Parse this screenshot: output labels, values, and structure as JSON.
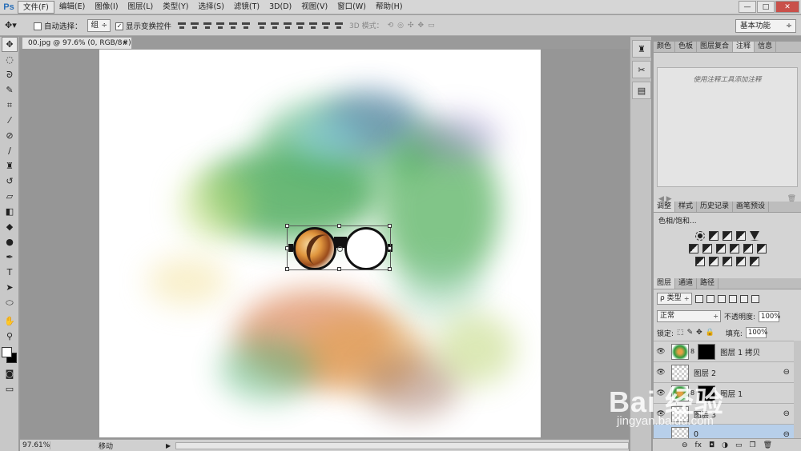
{
  "app": {
    "logo": "Ps"
  },
  "menu": [
    "文件(F)",
    "编辑(E)",
    "图像(I)",
    "图层(L)",
    "类型(Y)",
    "选择(S)",
    "滤镜(T)",
    "3D(D)",
    "视图(V)",
    "窗口(W)",
    "帮助(H)"
  ],
  "window_controls": {
    "minimize": "—",
    "restore": "□",
    "close": "✕"
  },
  "options": {
    "auto_select_label": "自动选择：",
    "auto_select_value": "组",
    "show_transform_label": "显示变换控件",
    "show_transform_checked": "✓",
    "mode3d_label": "3D 模式：",
    "workspace": "基本功能"
  },
  "document": {
    "tab_title": "00.jpg @ 97.6% (0, RGB/8#) *",
    "close": "×"
  },
  "status": {
    "zoom": "97.61%",
    "tool": "移动",
    "arrow": "▶"
  },
  "notes_panel": {
    "tabs": [
      "颜色",
      "色板",
      "图层复合",
      "注释",
      "信息"
    ],
    "active_tab": 3,
    "hint": "使用注释工具添加注释"
  },
  "adjust_panel": {
    "tabs": [
      "调整",
      "样式",
      "历史记录",
      "画笔预设"
    ],
    "active_tab": 0,
    "title": "色相/饱和..."
  },
  "layers_panel": {
    "tabs": [
      "图层",
      "通道",
      "路径"
    ],
    "active_tab": 0,
    "filter_kind": "ρ 类型",
    "blend_mode": "正常",
    "opacity_label": "不透明度:",
    "opacity": "100%",
    "lock_label": "锁定:",
    "fill_label": "填充:",
    "fill": "100%",
    "layers": [
      {
        "name": "图层 1 拷贝",
        "visible": true,
        "has_mask": true,
        "selected": false
      },
      {
        "name": "图层 2",
        "visible": true,
        "has_mask": false,
        "selected": false
      },
      {
        "name": "图层 1",
        "visible": true,
        "has_mask": true,
        "selected": false
      },
      {
        "name": "图层 3",
        "visible": true,
        "has_mask": false,
        "selected": false
      },
      {
        "name": "0",
        "visible": false,
        "has_mask": false,
        "selected": true
      }
    ]
  },
  "watermark": {
    "main": "Bai 经验",
    "sub": "jingyan.baidu.com"
  },
  "colors": {
    "accent": "#2a6fb8",
    "selected_layer": "#b7cfea"
  }
}
